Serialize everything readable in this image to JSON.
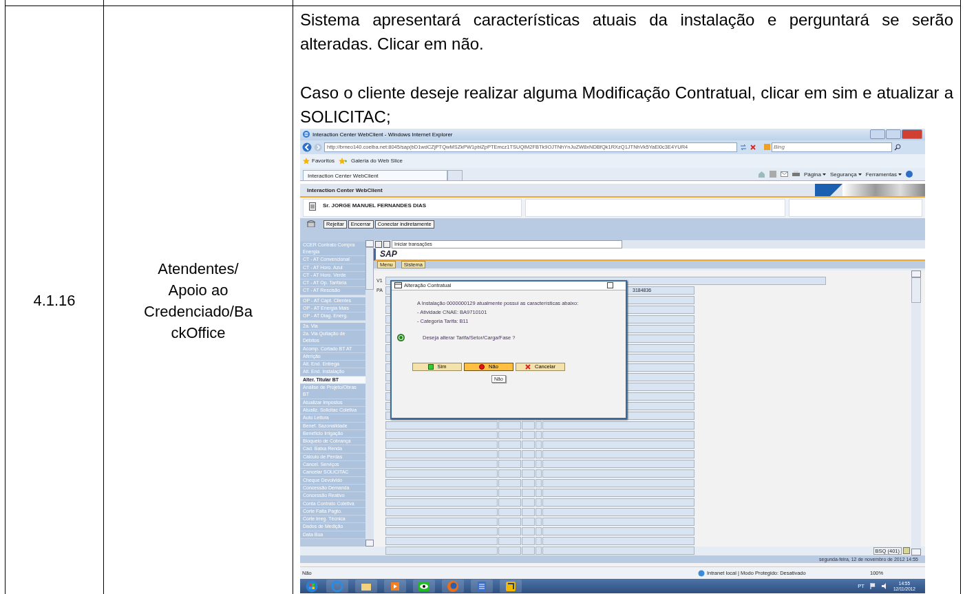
{
  "document_row": {
    "number": "4.1.16",
    "role_lines": [
      "Atendentes/",
      "Apoio ao",
      "Credenciado/Ba",
      "ckOffice"
    ],
    "paragraphs": [
      "Sistema apresentará características atuais da instalação e perguntará se serão alteradas.  Clicar em não.",
      "Caso o cliente deseje realizar alguma Modificação Contratual, clicar em sim e atualizar a SOLICITAC;"
    ]
  },
  "browser": {
    "title": "Interaction Center WebClient - Windows Internet Explorer",
    "url": "http://brneo140.coelba.net:8045/sap(bD1wdCZjPTQwMSZkPW1pbiZpPTEmcz1TSUQlM2FBTk9OJTNhYnJuZW8xNDBfQk1RXzQ1JTNhVk5YaEl0c3E4YUR4",
    "search_placeholder": "Bing",
    "favorites": "Favoritos",
    "favorites_links": [
      "Galeria do Web Slice"
    ],
    "tabs": [
      {
        "label": "Interaction Center WebClient",
        "selected": true
      }
    ],
    "command_menus": [
      "Página",
      "Segurança",
      "Ferramentas"
    ],
    "status_text": "Não",
    "zone": "Intranet local | Modo Protegido: Desativado",
    "zoom": "100%"
  },
  "app": {
    "header": "Interaction Center WebClient",
    "customer": "Sr. JORGE MANUEL FERNANDES DIAS",
    "toolbar_buttons": [
      "Rejeitar",
      "Encerrar",
      "Conectar indiretamente"
    ],
    "transaction_select": "Iniciar transações",
    "title": "SAP",
    "menus": [
      "Menu",
      "Sistema"
    ],
    "sidebar_groups": [
      [
        {
          "label": "CCER Contrato Compra Energia",
          "selected": false
        },
        {
          "label": "CT - AT Convencional",
          "selected": false
        },
        {
          "label": "CT - AT Horo. Azul",
          "selected": false
        },
        {
          "label": "CT - AT Horo. Verde",
          "selected": false
        },
        {
          "label": "CT - AT Op. Tarifária",
          "selected": false
        },
        {
          "label": "CT - AT Rescisão",
          "selected": false
        }
      ],
      [
        {
          "label": "OP - AT Capt. Clientes",
          "selected": false
        },
        {
          "label": "OP - AT Energia Mais",
          "selected": false
        },
        {
          "label": "OP - AT Diag. Energ.",
          "selected": false
        }
      ],
      [
        {
          "label": "2a. Via",
          "selected": false
        },
        {
          "label": "2a. Via Quitação de Débitos",
          "selected": false
        },
        {
          "label": "Acomp. Cortado BT AT",
          "selected": false
        },
        {
          "label": "Aferição",
          "selected": false
        },
        {
          "label": "Alt. End. Entrega",
          "selected": false
        },
        {
          "label": "Alt. End. Instalação",
          "selected": false
        },
        {
          "label": "Alter. Titular BT",
          "selected": true
        },
        {
          "label": "Análise de Projeto/Obras BT",
          "selected": false
        },
        {
          "label": "Atualizar Impostos",
          "selected": false
        },
        {
          "label": "Atualiz. Solicitac Coletiva",
          "selected": false
        },
        {
          "label": "Auto Leitura",
          "selected": false
        },
        {
          "label": "Benef. Sazonalidade",
          "selected": false
        },
        {
          "label": "Benefício Irrigação",
          "selected": false
        },
        {
          "label": "Bloqueio de Cobrança",
          "selected": false
        },
        {
          "label": "Cad. Baixa Renda",
          "selected": false
        },
        {
          "label": "Cálculo de Perdas",
          "selected": false
        },
        {
          "label": "Cancel. Serviços",
          "selected": false
        },
        {
          "label": "Cancelar SOLICITAC",
          "selected": false
        },
        {
          "label": "Cheque Devolvido",
          "selected": false
        },
        {
          "label": "Concessão Demanda",
          "selected": false
        },
        {
          "label": "Concessão Reativo",
          "selected": false
        },
        {
          "label": "Conta Contrato Coletiva",
          "selected": false
        },
        {
          "label": "Corte Falta Pagto.",
          "selected": false
        },
        {
          "label": "Corte Irreg. Técnica",
          "selected": false
        },
        {
          "label": "Dados de Medição",
          "selected": false
        },
        {
          "label": "Data Boa",
          "selected": false
        }
      ]
    ],
    "field_labels": [
      "V1",
      "PA"
    ],
    "field_value": "3184836",
    "dialog": {
      "title": "Alteração Contratual",
      "lines": [
        "A Instalação 0000000129 atualmente possui as características abaixo:",
        "- Atividade CNAE: BA9710101",
        "- Categoria Tarifa: B11"
      ],
      "question": "Deseja alterar Tarifa/Setor/Carga/Fase ?",
      "buttons": [
        {
          "label": "Sim",
          "kind": "yes",
          "selected": false
        },
        {
          "label": "Não",
          "kind": "no",
          "selected": true
        },
        {
          "label": "Cancelar",
          "kind": "cancel",
          "selected": false
        }
      ],
      "tooltip": "Não"
    },
    "queue": "BSQ (401)",
    "datetime": "segunda-feira, 12 de novembro de 2012 14:55"
  },
  "taskbar": {
    "language": "PT",
    "time": "14:55",
    "date": "12/11/2012"
  }
}
